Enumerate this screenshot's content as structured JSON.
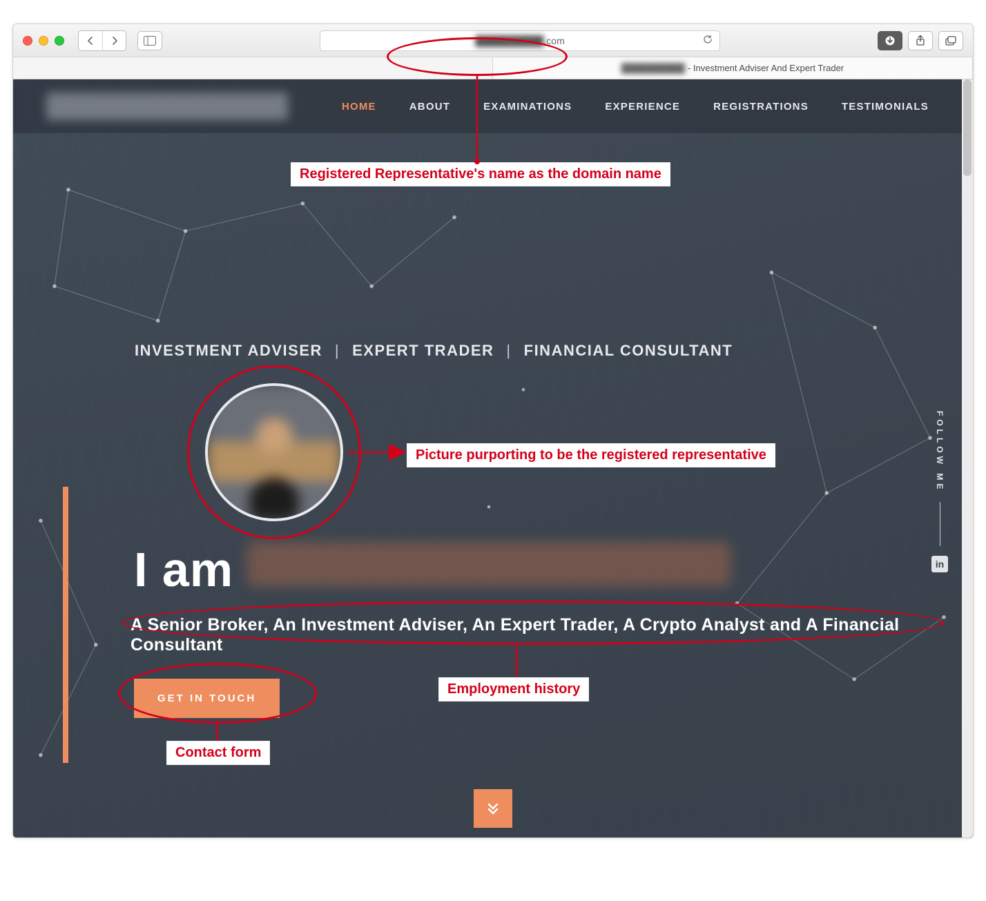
{
  "browser": {
    "url_hidden_prefix": "██████████",
    "url_visible_suffix": ".com",
    "tab_title_hidden": "██████████",
    "tab_title_suffix": " - Investment Adviser And Expert Trader"
  },
  "nav": {
    "items": [
      {
        "label": "HOME",
        "active": true
      },
      {
        "label": "ABOUT",
        "active": false
      },
      {
        "label": "EXAMINATIONS",
        "active": false
      },
      {
        "label": "EXPERIENCE",
        "active": false
      },
      {
        "label": "REGISTRATIONS",
        "active": false
      },
      {
        "label": "TESTIMONIALS",
        "active": false
      }
    ]
  },
  "hero": {
    "roles": [
      "INVESTMENT ADVISER",
      "EXPERT TRADER",
      "FINANCIAL CONSULTANT"
    ],
    "iam_prefix": "I am",
    "subtitle": "A Senior Broker, An Investment Adviser, An Expert Trader, A Crypto Analyst and A Financial Consultant",
    "cta": "GET IN TOUCH"
  },
  "follow": {
    "label": "FOLLOW ME",
    "linkedin": "in"
  },
  "annotations": {
    "domain": "Registered Representative's name as the domain name",
    "photo": "Picture purporting to be the registered representative",
    "employment": "Employment history",
    "contact": "Contact form"
  },
  "colors": {
    "accent": "#ee8e5e",
    "anno": "#d4001a"
  }
}
